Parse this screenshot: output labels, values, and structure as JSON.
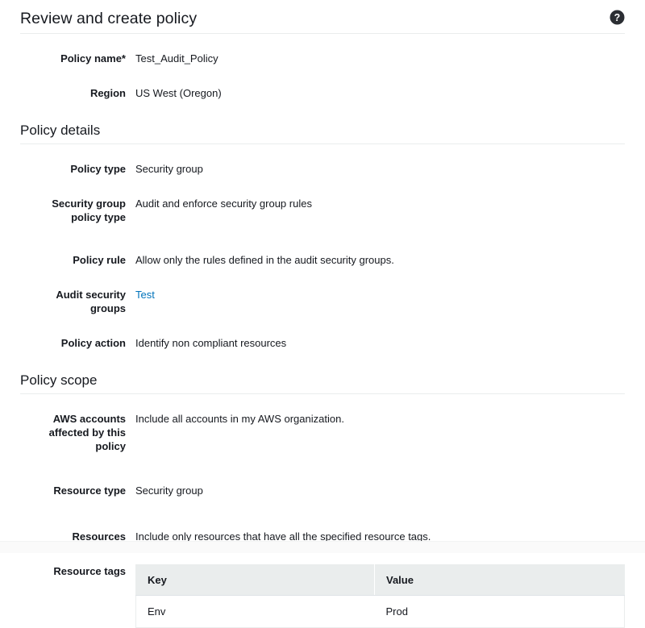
{
  "header": {
    "title": "Review and create policy",
    "help_icon": "help-circle-icon"
  },
  "summary_fields": [
    {
      "label": "Policy name*",
      "value": "Test_Audit_Policy",
      "type": "text"
    },
    {
      "label": "Region",
      "value": "US West (Oregon)",
      "type": "text"
    }
  ],
  "sections": [
    {
      "heading": "Policy details",
      "fields": [
        {
          "label": "Policy type",
          "value": "Security group",
          "type": "text"
        },
        {
          "label": "Security group policy type",
          "value": "Audit and enforce security group rules",
          "type": "text"
        },
        {
          "label": "Policy rule",
          "value": "Allow only the rules defined in the audit security groups.",
          "type": "text"
        },
        {
          "label": "Audit security groups",
          "value": "Test",
          "type": "link"
        },
        {
          "label": "Policy action",
          "value": "Identify non compliant resources",
          "type": "text"
        }
      ]
    },
    {
      "heading": "Policy scope",
      "fields": [
        {
          "label": "AWS accounts affected by this policy",
          "value": "Include all accounts in my AWS organization.",
          "type": "text"
        },
        {
          "label": "Resource type",
          "value": "Security group",
          "type": "text"
        },
        {
          "label": "Resources",
          "value": "Include only resources that have all the specified resource tags.",
          "type": "text"
        }
      ]
    }
  ],
  "resource_tags": {
    "label": "Resource tags",
    "columns": [
      "Key",
      "Value"
    ],
    "rows": [
      {
        "key": "Env",
        "value": "Prod"
      }
    ]
  },
  "colors": {
    "link": "#0073bb",
    "text": "#16191f",
    "divider": "#eaeded",
    "table_header_bg": "#eaeded"
  }
}
